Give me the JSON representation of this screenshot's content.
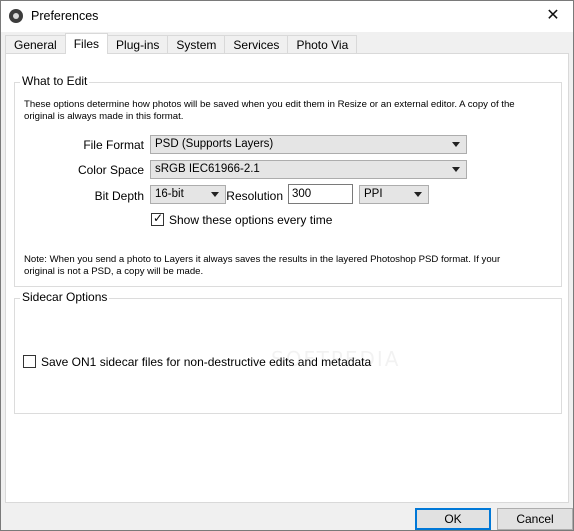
{
  "window": {
    "title": "Preferences",
    "close_symbol": "✕"
  },
  "tabs": [
    {
      "label": "General"
    },
    {
      "label": "Files",
      "active": true
    },
    {
      "label": "Plug-ins"
    },
    {
      "label": "System"
    },
    {
      "label": "Services"
    },
    {
      "label": "Photo Via"
    }
  ],
  "what_to_edit": {
    "title": "What to Edit",
    "description_line1": "These options determine how photos will be saved when you edit them in Resize or an external editor.  A copy of the",
    "description_line2": "original is always made in this format.",
    "file_format": {
      "label": "File Format",
      "value": "PSD (Supports Layers)"
    },
    "color_space": {
      "label": "Color Space",
      "value": "sRGB IEC61966-2.1"
    },
    "bit_depth": {
      "label": "Bit Depth",
      "value": "16-bit"
    },
    "resolution": {
      "label": "Resolution",
      "value": "300",
      "unit": "PPI"
    },
    "show_options": {
      "label": "Show these options every time",
      "checked": true
    },
    "note_line1": "Note: When you send a photo to Layers it always saves the results in the layered Photoshop PSD format.  If your",
    "note_line2": "original is not a PSD, a copy will be made."
  },
  "sidecar": {
    "title": "Sidecar Options",
    "save_sidecar": {
      "label": "Save ON1 sidecar files for non-destructive edits and metadata",
      "checked": false
    }
  },
  "buttons": {
    "ok": "OK",
    "cancel": "Cancel"
  },
  "watermark": "SOFTPEDIA"
}
